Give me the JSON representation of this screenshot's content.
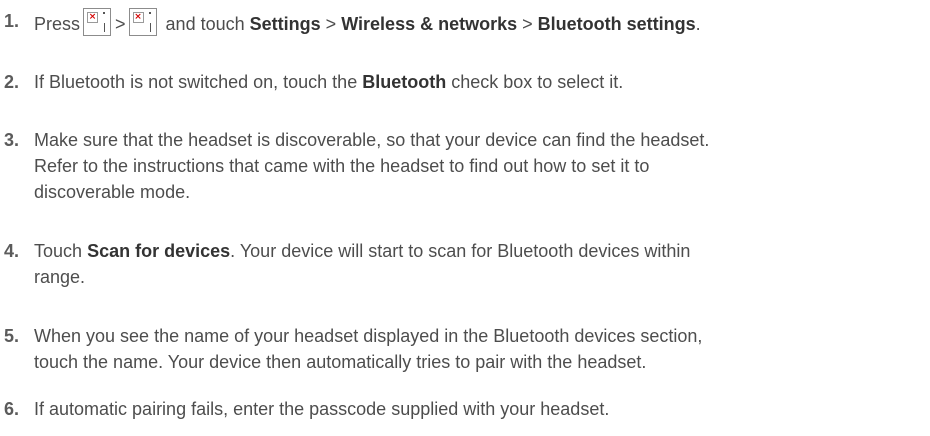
{
  "steps": [
    {
      "num": "1.",
      "parts": {
        "a": "Press",
        "gt1": ">",
        "b": "and touch",
        "settings": "Settings",
        "gt2": ">",
        "wireless": "Wireless & networks",
        "gt3": ">",
        "bt_settings": "Bluetooth settings",
        "end": "."
      },
      "icons": [
        "menu-key-icon",
        "menu-key-icon"
      ]
    },
    {
      "num": "2.",
      "parts": {
        "a": "If Bluetooth is not switched on, touch the",
        "bluetooth": "Bluetooth",
        "b": "check box to select it."
      }
    },
    {
      "num": "3.",
      "lines": [
        "Make sure that the headset is discoverable, so that your device can find the headset.",
        "Refer to the instructions that came with the headset to find out how to set it to",
        "discoverable mode."
      ]
    },
    {
      "num": "4.",
      "parts": {
        "a": "Touch",
        "scan": "Scan for devices",
        "b": ". Your device will start to scan for Bluetooth devices within"
      },
      "line2": "range."
    },
    {
      "num": "5.",
      "lines": [
        "When you see the name of your headset displayed in the Bluetooth devices section,",
        "touch the name. Your device then automatically tries to pair with the headset."
      ]
    },
    {
      "num": "6.",
      "lines": [
        "If automatic pairing fails, enter the passcode supplied with your headset."
      ]
    }
  ]
}
